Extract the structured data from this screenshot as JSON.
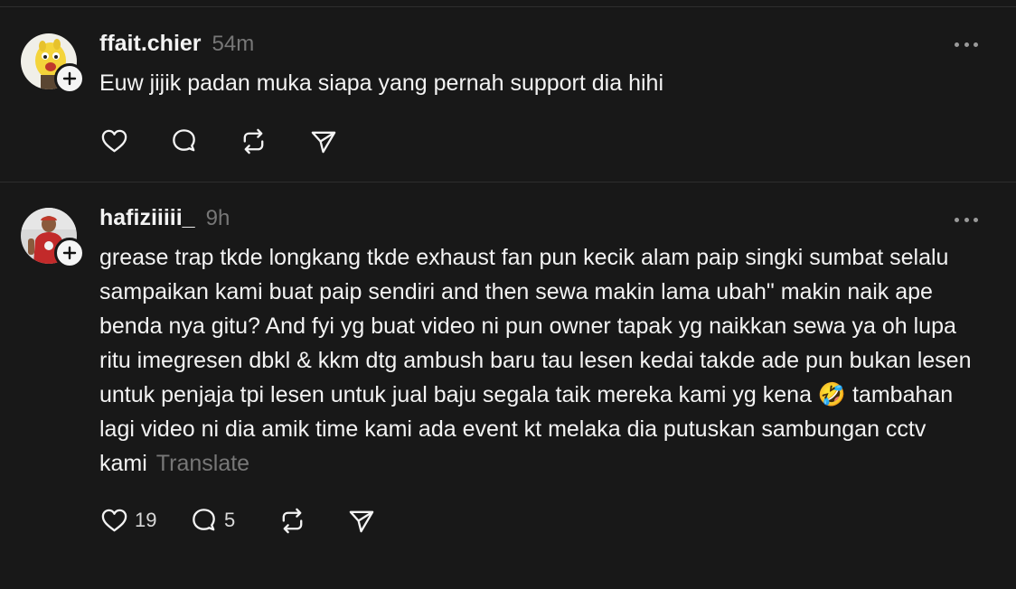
{
  "posts": [
    {
      "username": "ffait.chier",
      "time": "54m",
      "text": "Euw jijik padan muka siapa yang pernah support dia hihi",
      "likes": "",
      "replies": "",
      "translate": ""
    },
    {
      "username": "hafiziiiii_",
      "time": "9h",
      "text": "grease trap tkde longkang tkde exhaust fan pun kecik alam paip singki sumbat selalu sampaikan kami buat paip sendiri and then sewa makin lama ubah\" makin naik ape benda nya gitu? And fyi yg buat video ni pun owner tapak yg naikkan sewa ya oh lupa ritu imegresen dbkl & kkm dtg ambush baru tau lesen kedai takde ade pun bukan lesen untuk penjaja tpi lesen untuk jual baju segala taik mereka kami yg kena 🤣 tambahan lagi video ni dia amik time kami ada event kt melaka dia putuskan sambungan cctv kami",
      "likes": "19",
      "replies": "5",
      "translate": "Translate"
    }
  ],
  "icons": {
    "like": "heart-icon",
    "reply": "comment-icon",
    "repost": "repost-icon",
    "share": "send-icon",
    "more": "more-dots-icon",
    "follow": "plus-icon"
  },
  "colors": {
    "background": "#181818",
    "primary_text": "#f3f3f3",
    "secondary_text": "#777777",
    "divider": "#2e2e2e"
  }
}
